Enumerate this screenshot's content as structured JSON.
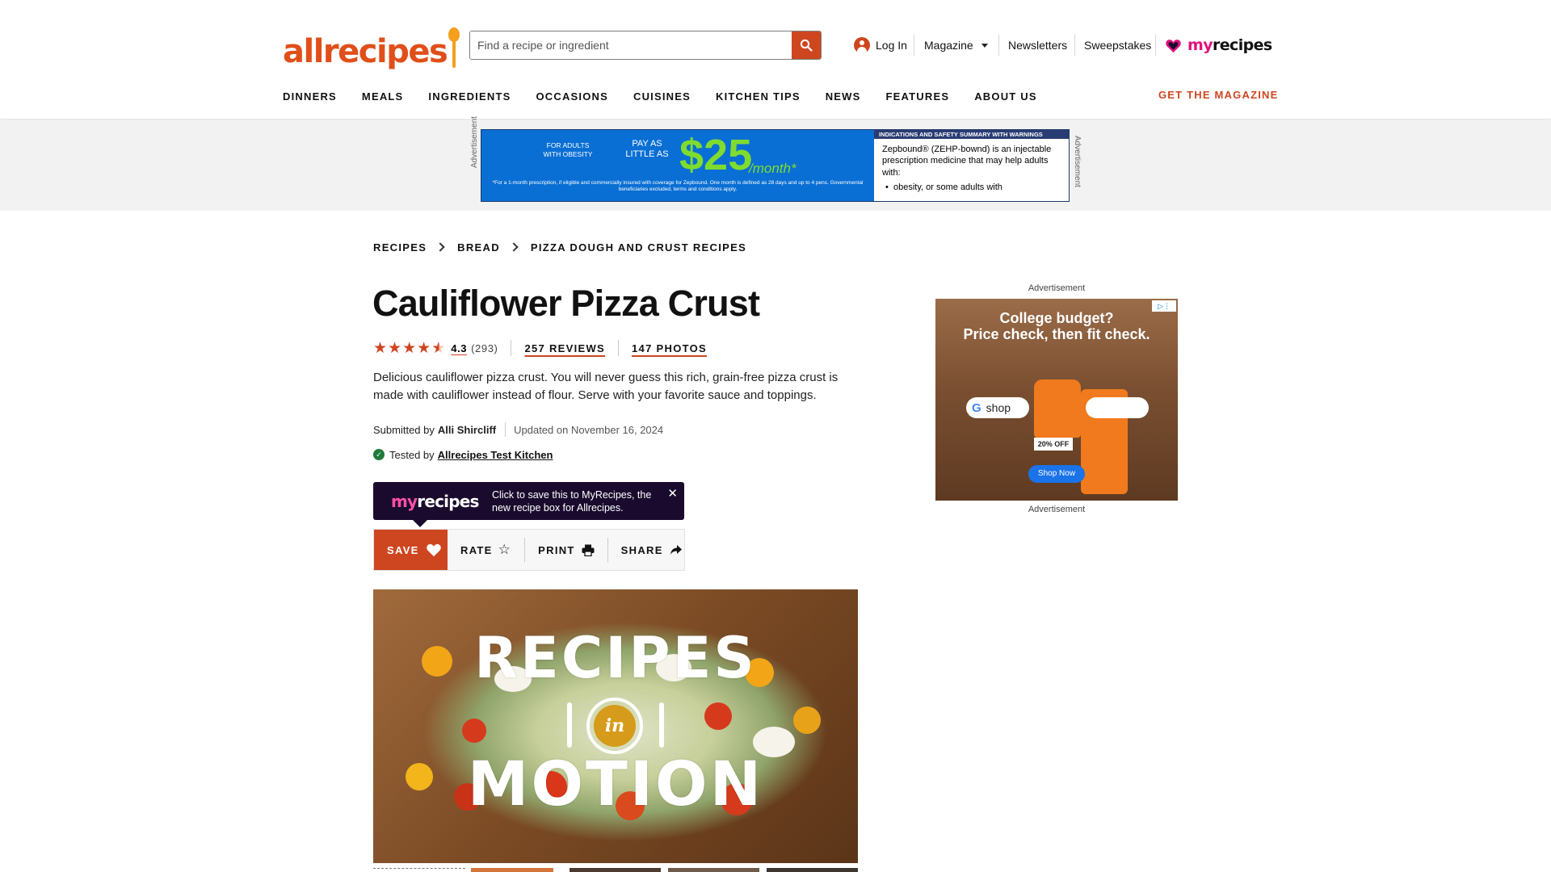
{
  "header": {
    "logo_text": "allrecipes",
    "search": {
      "placeholder": "Find a recipe or ingredient",
      "value": ""
    },
    "login_label": "Log In",
    "magazine_label": "Magazine",
    "newsletters_label": "Newsletters",
    "sweepstakes_label": "Sweepstakes",
    "myrecipes_my": "my",
    "myrecipes_rec": "recipes",
    "nav": [
      "DINNERS",
      "MEALS",
      "INGREDIENTS",
      "OCCASIONS",
      "CUISINES",
      "KITCHEN TIPS",
      "NEWS",
      "FEATURES",
      "ABOUT US"
    ],
    "get_magazine": "GET THE MAGAZINE",
    "brand_color": "#ce4620"
  },
  "top_ad": {
    "label": "Advertisement",
    "adults": "FOR ADULTS\nWITH OBESITY",
    "pay": "PAY AS\nLITTLE AS",
    "price": "$25",
    "per": "/month*",
    "fine_print": "*For a 1-month prescription, if eligible and commercially insured with coverage for Zepbound. One month is defined as 28 days and up to 4 pens. Governmental beneficiaries excluded, terms and conditions apply.",
    "right_head": "INDICATIONS AND SAFETY SUMMARY WITH WARNINGS",
    "right_body": "Zepbound® (ZEHP-bownd) is an injectable prescription medicine that may help adults with:",
    "right_bullet": "obesity, or some adults with"
  },
  "breadcrumb": [
    "RECIPES",
    "BREAD",
    "PIZZA DOUGH AND CRUST RECIPES"
  ],
  "recipe": {
    "title": "Cauliflower Pizza Crust",
    "rating": 4.3,
    "rating_display": "4.3",
    "rating_count": "(293)",
    "reviews": "257 REVIEWS",
    "photos": "147 PHOTOS",
    "description": "Delicious cauliflower pizza crust. You will never guess this rich, grain-free pizza crust is made with cauliflower instead of flour. Serve with your favorite sauce and toppings.",
    "submitted_prefix": "Submitted by",
    "author": "Alli Shircliff",
    "updated": "Updated on November 16, 2024",
    "tested_prefix": "Tested by",
    "tested_by": "Allrecipes Test Kitchen"
  },
  "promo": {
    "text": "Click to save this to MyRecipes, the new recipe box for Allrecipes."
  },
  "actions": {
    "save": "SAVE",
    "rate": "RATE",
    "print": "PRINT",
    "share": "SHARE"
  },
  "hero": {
    "line1": "RECIPES",
    "in": "in",
    "line2": "MOTION"
  },
  "side_ad": {
    "label_top": "Advertisement",
    "label_bottom": "Advertisement",
    "headline": "College budget?\nPrice check, then fit check.",
    "search_text": "shop",
    "discount": "20% OFF",
    "cta": "Shop Now"
  }
}
